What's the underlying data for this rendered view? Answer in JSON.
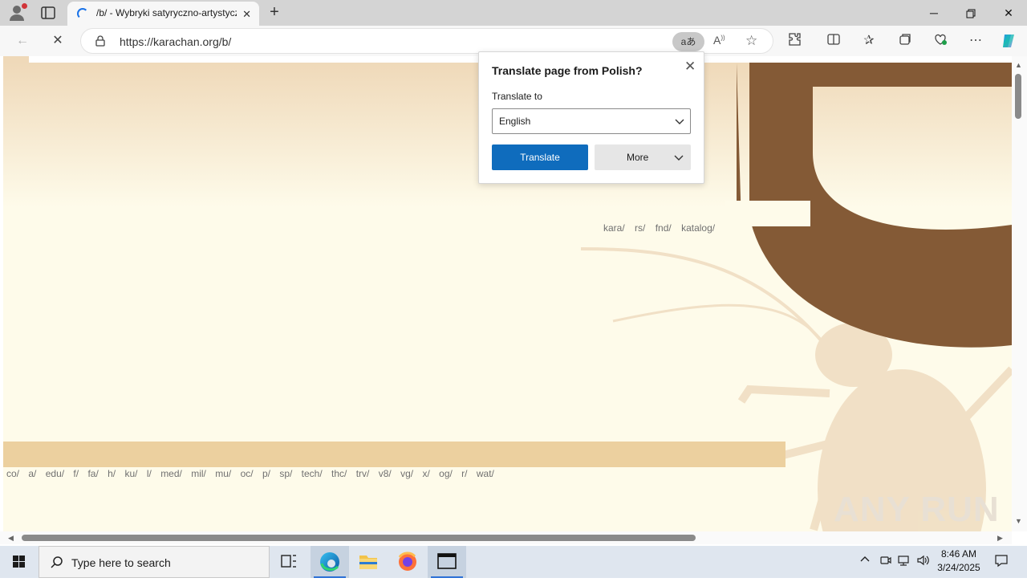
{
  "browser": {
    "tab_title": "/b/ - Wybryki satyryczno-artystyczne",
    "url": "https://karachan.org/b/",
    "translate_pill": "aあ"
  },
  "translate_popup": {
    "title": "Translate page from Polish?",
    "translate_to_label": "Translate to",
    "selected_language": "English",
    "translate_button": "Translate",
    "more_button": "More"
  },
  "page": {
    "top_links": [
      "kara/",
      "rs/",
      "fnd/",
      "katalog/"
    ],
    "board_links": [
      "co/",
      "a/",
      "edu/",
      "f/",
      "fa/",
      "h/",
      "ku/",
      "l/",
      "med/",
      "mil/",
      "mu/",
      "oc/",
      "p/",
      "sp/",
      "tech/",
      "thc/",
      "trv/",
      "v8/",
      "vg/",
      "x/",
      "og/",
      "r/",
      "wat/"
    ],
    "watermark": "ANY RUN",
    "colors": {
      "background": "#fefbea",
      "brown": "#845a36",
      "tan_bar": "#ecd09f"
    }
  },
  "taskbar": {
    "search_placeholder": "Type here to search",
    "time": "8:46 AM",
    "date": "3/24/2025"
  }
}
